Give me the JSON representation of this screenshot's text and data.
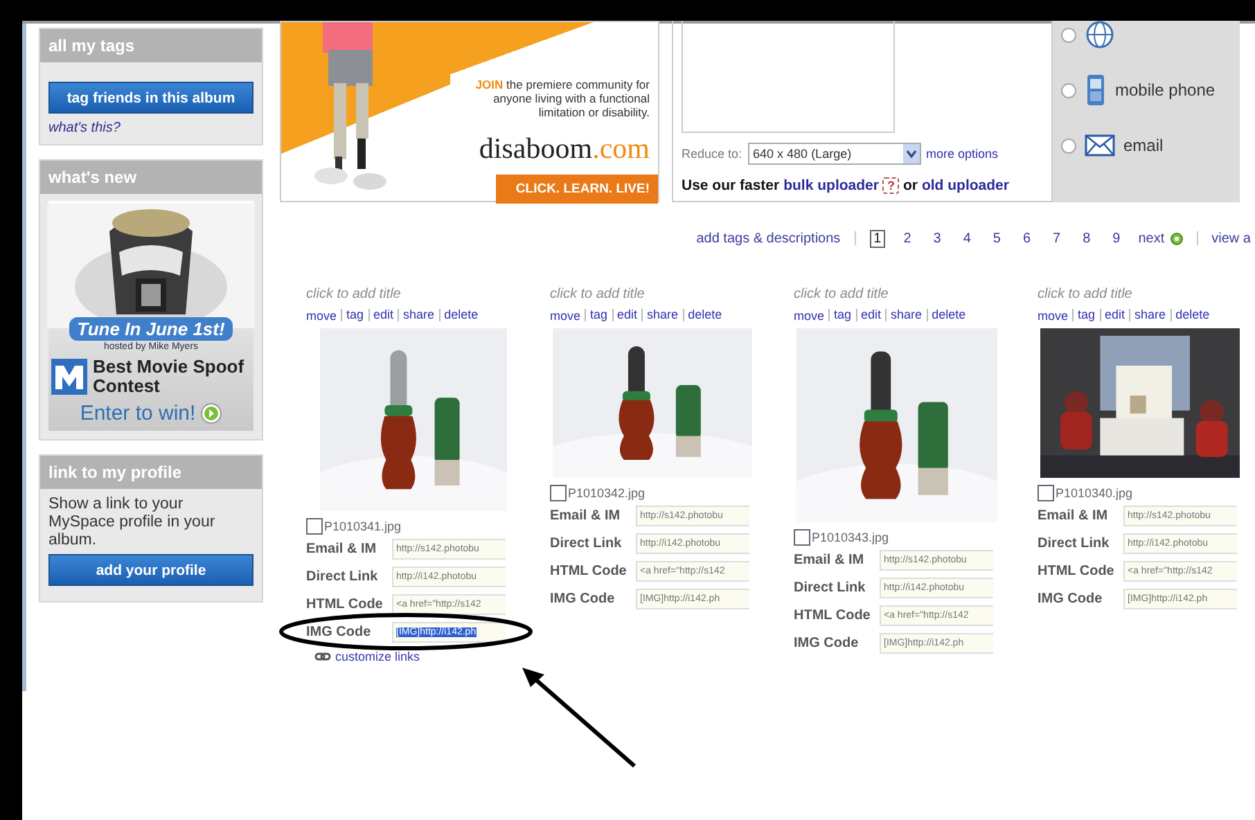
{
  "sidebar": {
    "boxes": [
      {
        "kind": "tags",
        "title": "all my tags",
        "button": "tag friends in this album",
        "link": "what's this?"
      },
      {
        "kind": "promo",
        "title": "what's new",
        "ribbon": "Tune In June 1st!",
        "host": "hosted by Mike Myers",
        "headline": "Best Movie Spoof Contest",
        "cta": "Enter to win!"
      },
      {
        "kind": "profile",
        "title": "link to my profile",
        "text": "Show a link to your MySpace profile in your album.",
        "button": "add your profile"
      }
    ]
  },
  "ad": {
    "join": "JOIN",
    "tagline": "the premiere community for anyone living with a functional limitation or disability.",
    "brand": "disaboom",
    "brand_suffix": ".com",
    "cta": "CLICK. LEARN. LIVE!"
  },
  "upload": {
    "reduce_label": "Reduce to:",
    "reduce_value": "640 x 480 (Large)",
    "more_options": "more options",
    "faster": "Use our faster",
    "bulk": "bulk uploader",
    "help": "?",
    "or": "or",
    "old": "old uploader"
  },
  "upload_methods": [
    {
      "kind": "web",
      "selected": false
    },
    {
      "kind": "phone",
      "label": "mobile phone",
      "selected": false
    },
    {
      "kind": "email",
      "label": "email",
      "selected": false
    }
  ],
  "pagination": {
    "link": "add tags & descriptions",
    "pages": [
      {
        "label": "1",
        "selected": true
      },
      {
        "label": "2",
        "selected": false
      },
      {
        "label": "3",
        "selected": false
      },
      {
        "label": "4",
        "selected": false
      },
      {
        "label": "5",
        "selected": false
      },
      {
        "label": "6",
        "selected": false
      },
      {
        "label": "7",
        "selected": false
      },
      {
        "label": "8",
        "selected": false
      },
      {
        "label": "9",
        "selected": false
      }
    ],
    "next": "next",
    "view_all": "view a"
  },
  "photos": [
    {
      "title": "click to add title",
      "actions": [
        "move",
        "tag",
        "edit",
        "share",
        "delete"
      ],
      "filename": "P1010341.jpg",
      "checked": false,
      "fields": [
        {
          "label": "Email & IM",
          "value": "http://s142.photobu",
          "selected": false
        },
        {
          "label": "Direct Link",
          "value": "http://i142.photobu",
          "selected": false
        },
        {
          "label": "HTML Code",
          "value": "<a href=\"http://s142",
          "selected": false
        },
        {
          "label": "IMG Code",
          "value": "[IMG]http://i142.ph",
          "selected": true
        }
      ],
      "customize": "customize links"
    },
    {
      "title": "click to add title",
      "actions": [
        "move",
        "tag",
        "edit",
        "share",
        "delete"
      ],
      "filename": "P1010342.jpg",
      "checked": false,
      "fields": [
        {
          "label": "Email & IM",
          "value": "http://s142.photobu",
          "selected": false
        },
        {
          "label": "Direct Link",
          "value": "http://i142.photobu",
          "selected": false
        },
        {
          "label": "HTML Code",
          "value": "<a href=\"http://s142",
          "selected": false
        },
        {
          "label": "IMG Code",
          "value": "[IMG]http://i142.ph",
          "selected": false
        }
      ]
    },
    {
      "title": "click to add title",
      "actions": [
        "move",
        "tag",
        "edit",
        "share",
        "delete"
      ],
      "filename": "P1010343.jpg",
      "checked": false,
      "fields": [
        {
          "label": "Email & IM",
          "value": "http://s142.photobu",
          "selected": false
        },
        {
          "label": "Direct Link",
          "value": "http://i142.photobu",
          "selected": false
        },
        {
          "label": "HTML Code",
          "value": "<a href=\"http://s142",
          "selected": false
        },
        {
          "label": "IMG Code",
          "value": "[IMG]http://i142.ph",
          "selected": false
        }
      ]
    },
    {
      "title": "click to add title",
      "actions": [
        "move",
        "tag",
        "edit",
        "share",
        "delete"
      ],
      "filename": "P1010340.jpg",
      "checked": false,
      "fields": [
        {
          "label": "Email & IM",
          "value": "http://s142.photobu",
          "selected": false
        },
        {
          "label": "Direct Link",
          "value": "http://i142.photobu",
          "selected": false
        },
        {
          "label": "HTML Code",
          "value": "<a href=\"http://s142",
          "selected": false
        },
        {
          "label": "IMG Code",
          "value": "[IMG]http://i142.ph",
          "selected": false
        }
      ]
    }
  ]
}
